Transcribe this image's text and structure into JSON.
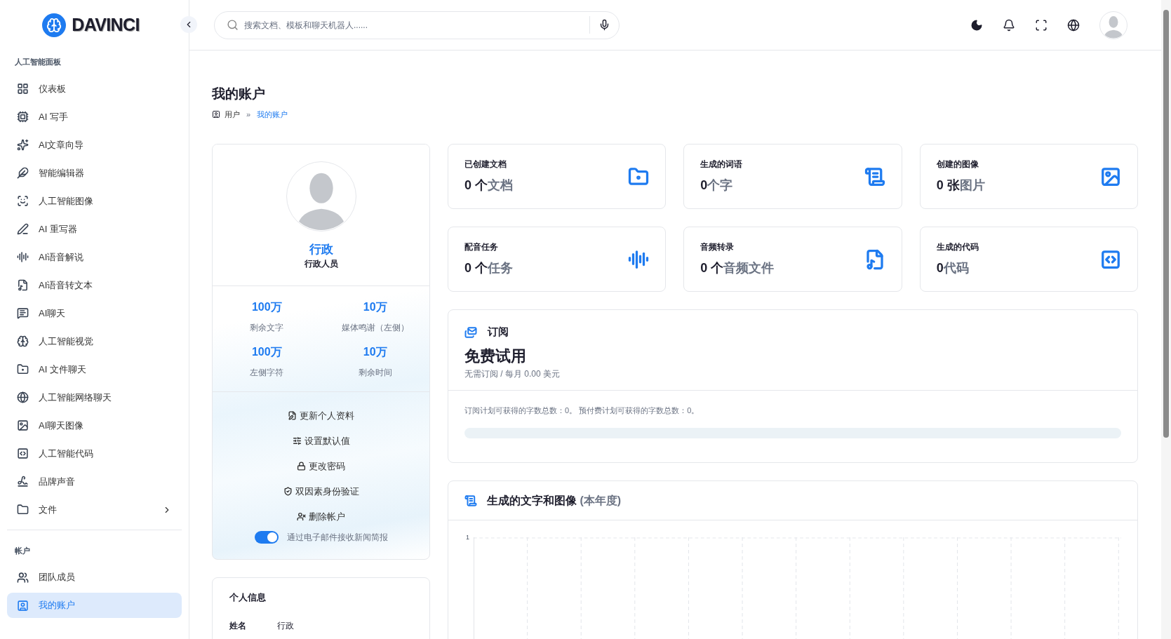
{
  "sidebar": {
    "logo_text": "DAVINCI",
    "sections": [
      {
        "title": "人工智能面板",
        "items": [
          {
            "label": "仪表板",
            "selected": false,
            "submenu": false
          },
          {
            "label": "AI 写手",
            "selected": false,
            "submenu": false
          },
          {
            "label": "AI文章向导",
            "selected": false,
            "submenu": false
          },
          {
            "label": "智能编辑器",
            "selected": false,
            "submenu": false
          },
          {
            "label": "人工智能图像",
            "selected": false,
            "submenu": false
          },
          {
            "label": "AI 重写器",
            "selected": false,
            "submenu": false
          },
          {
            "label": "AI语音解说",
            "selected": false,
            "submenu": false
          },
          {
            "label": "AI语音转文本",
            "selected": false,
            "submenu": false
          },
          {
            "label": "AI聊天",
            "selected": false,
            "submenu": false
          },
          {
            "label": "人工智能视觉",
            "selected": false,
            "submenu": false
          },
          {
            "label": "AI 文件聊天",
            "selected": false,
            "submenu": false
          },
          {
            "label": "人工智能网络聊天",
            "selected": false,
            "submenu": false
          },
          {
            "label": "AI聊天图像",
            "selected": false,
            "submenu": false
          },
          {
            "label": "人工智能代码",
            "selected": false,
            "submenu": false
          },
          {
            "label": "品牌声音",
            "selected": false,
            "submenu": false
          },
          {
            "label": "文件",
            "selected": false,
            "submenu": true
          }
        ]
      },
      {
        "title": "帐户",
        "items": [
          {
            "label": "团队成员",
            "selected": false,
            "submenu": false
          },
          {
            "label": "我的账户",
            "selected": true,
            "submenu": false
          }
        ]
      }
    ]
  },
  "search": {
    "placeholder": "搜索文档、模板和聊天机器人......"
  },
  "page": {
    "title": "我的账户",
    "breadcrumb_separator": "»",
    "breadcrumb": [
      {
        "label": "用户",
        "selected": false
      },
      {
        "label": "我的账户",
        "selected": true
      }
    ]
  },
  "profile": {
    "name": "行政",
    "role": "行政人员",
    "stats": [
      {
        "value": "100万",
        "label": "剩余文字"
      },
      {
        "value": "10万",
        "label": "媒体鸣谢（左侧）"
      },
      {
        "value": "100万",
        "label": "左侧字符"
      },
      {
        "value": "10万",
        "label": "剩余时间"
      }
    ],
    "actions": [
      "更新个人资料",
      "设置默认值",
      "更改密码",
      "双因素身份验证",
      "删除帐户"
    ],
    "newsletter": {
      "label": "通过电子邮件接收新闻简报",
      "on": true
    }
  },
  "personal_info": {
    "title": "个人信息",
    "rows": [
      {
        "field": "姓名",
        "value": "行政"
      }
    ]
  },
  "stat_cards": [
    {
      "title": "已创建文档",
      "value": "0 个",
      "unit": "文档"
    },
    {
      "title": "生成的词语",
      "value": "0",
      "unit": "个字"
    },
    {
      "title": "创建的图像",
      "value": "0 张",
      "unit": "图片"
    },
    {
      "title": "配音任务",
      "value": "0 个",
      "unit": "任务"
    },
    {
      "title": "音频转录",
      "value": "0 个",
      "unit": "音频文件"
    },
    {
      "title": "生成的代码",
      "value": "0",
      "unit": "代码"
    }
  ],
  "subscription": {
    "title": "订阅",
    "plan": "免费试用",
    "price": "无需订阅 / 每月 0.00 美元",
    "note": "订阅计划可获得的字数总数：0。 预付费计划可获得的字数总数：0。",
    "level": 0
  },
  "chart_card": {
    "title": "生成的文字和图像",
    "period": "(本年度)",
    "ytick_label": "1"
  }
}
